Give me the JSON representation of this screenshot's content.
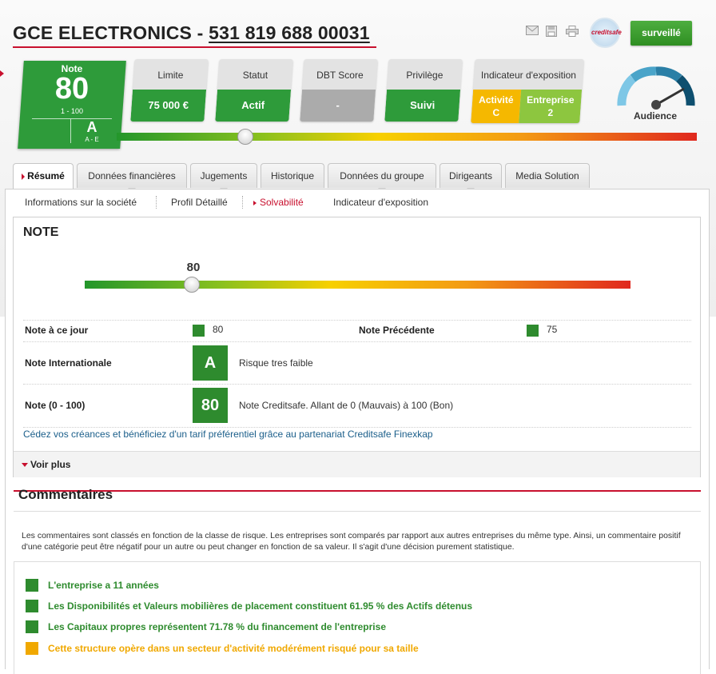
{
  "header": {
    "company": "GCE ELECTRONICS",
    "separator": "-",
    "siren": "531 819 688 00031",
    "logo_text": "creditsafe",
    "watch_button": "surveillé",
    "icons": [
      "mail-icon",
      "save-icon",
      "print-icon"
    ]
  },
  "summary": {
    "note_label": "Note",
    "note_value": "80",
    "note_range": "1 - 100",
    "grade": "A",
    "grade_range": "A - E",
    "kpis": [
      {
        "label": "Limite",
        "value": "75 000 €"
      },
      {
        "label": "Statut",
        "value": "Actif"
      },
      {
        "label": "DBT Score",
        "value": "-"
      },
      {
        "label": "Privilège",
        "value": "Suivi"
      }
    ],
    "exposure": {
      "label": "Indicateur d'exposition",
      "activity_label": "Activité",
      "activity_value": "C",
      "company_label": "Entreprise",
      "company_value": "2"
    },
    "audience_label": "Audience",
    "score_fraction": 0.8
  },
  "tabs": [
    "Résumé",
    "Données financières",
    "Jugements",
    "Historique",
    "Données du groupe",
    "Dirigeants",
    "Media Solution"
  ],
  "active_tab": "Résumé",
  "subnav": [
    "Informations sur la société",
    "Profil Détaillé",
    "Solvabilité",
    "Indicateur d'exposition"
  ],
  "active_subnav": "Solvabilité",
  "note_panel": {
    "title": "NOTE",
    "score": "80",
    "note_today_label": "Note à ce jour",
    "note_today_value": "80",
    "prev_label": "Note Précédente",
    "prev_value": "75",
    "intl_label": "Note Internationale",
    "intl_value": "A",
    "intl_desc": "Risque tres faible",
    "scale_label": "Note (0 - 100)",
    "scale_value": "80",
    "scale_desc": "Note Creditsafe. Allant de 0 (Mauvais) à 100 (Bon)",
    "promo": "Cédez vos créances et bénéficiez d'un tarif préférentiel grâce au partenariat Creditsafe Finexkap",
    "more": "Voir plus"
  },
  "comments": {
    "title": "Commentaires",
    "intro": "Les commentaires sont classés en fonction de la classe de risque. Les entreprises sont comparés par rapport aux autres entreprises du même type. Ainsi, un commentaire positif d'une catégorie peut être négatif pour un autre ou peut changer en fonction de sa valeur. Il s'agit d'une décision purement statistique.",
    "items": [
      {
        "text": "L'entreprise a 11 années",
        "color": "#2e8b2e"
      },
      {
        "text": "Les Disponibilités et Valeurs mobilières de placement constituent 61.95 % des Actifs détenus",
        "color": "#2e8b2e"
      },
      {
        "text": "Les Capitaux propres représentent 71.78 % du financement de l'entreprise",
        "color": "#2e8b2e"
      },
      {
        "text": "Cette structure opère dans un secteur d'activité modérément risqué pour sa taille",
        "color": "#f0a800"
      }
    ]
  },
  "colors": {
    "accent": "#c8102e",
    "green": "#2e9b3a",
    "amber": "#f0a800"
  }
}
